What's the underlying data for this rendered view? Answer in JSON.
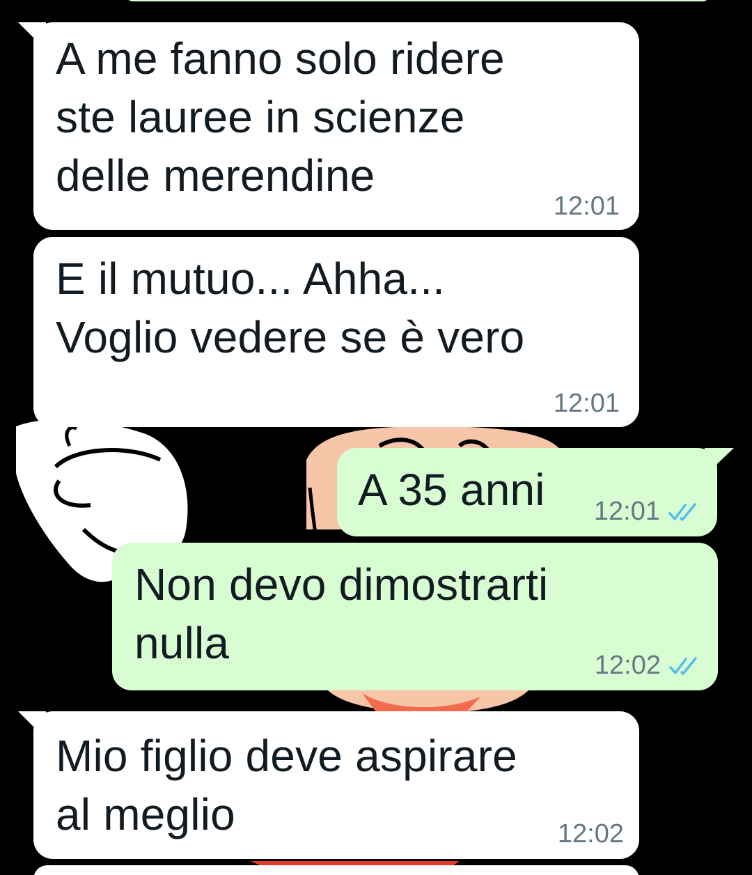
{
  "colors": {
    "background": "#000000",
    "incoming_bubble": "#ffffff",
    "outgoing_bubble": "#d9fdd3",
    "message_text": "#111b21",
    "timestamp": "#667781",
    "read_ticks": "#53bdeb"
  },
  "messages": [
    {
      "direction": "incoming",
      "text": "A me fanno solo ridere\nste lauree in scienze\ndelle merendine",
      "time": "12:01"
    },
    {
      "direction": "incoming",
      "text": "E il mutuo... Ahha...\nVoglio vedere se è vero",
      "time": "12:01"
    },
    {
      "direction": "outgoing",
      "text": "A 35 anni",
      "time": "12:01",
      "status_icon": "double-check-read-icon"
    },
    {
      "direction": "outgoing",
      "text": "Non devo dimostrarti\nnulla",
      "time": "12:02",
      "status_icon": "double-check-read-icon"
    },
    {
      "direction": "incoming",
      "text": "Mio figlio deve aspirare\nal meglio",
      "time": "12:02"
    }
  ]
}
